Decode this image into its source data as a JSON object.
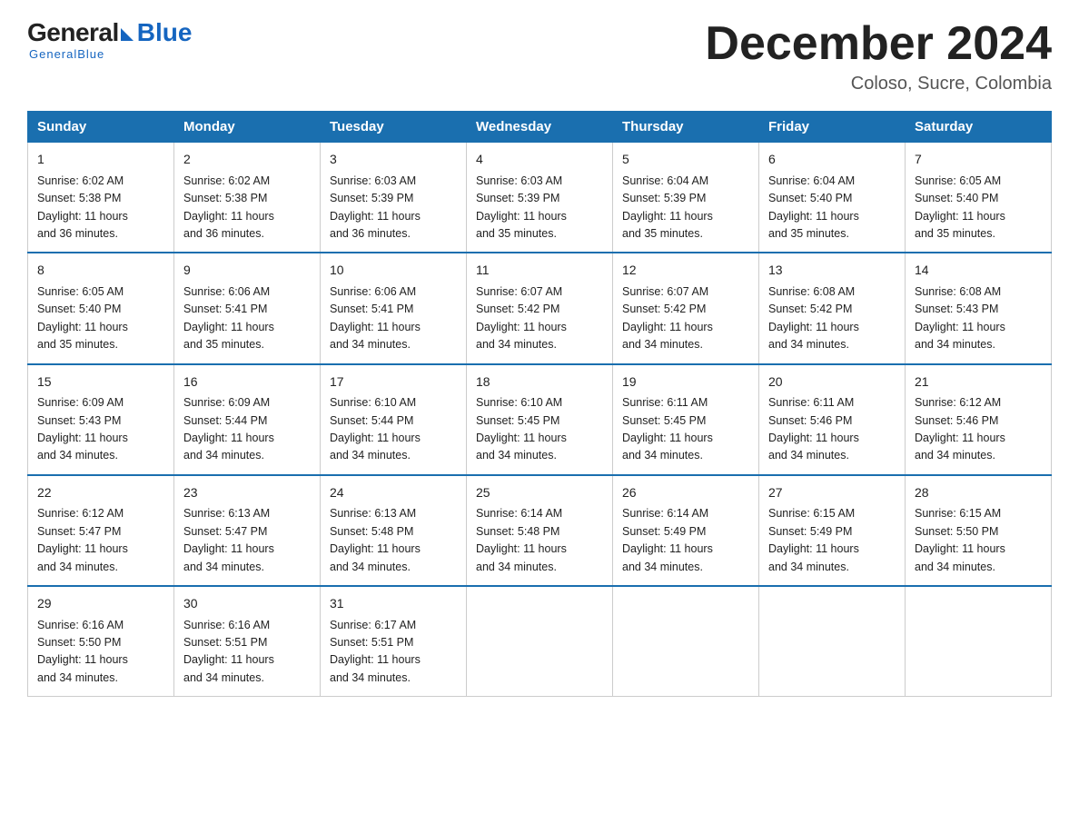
{
  "logo": {
    "general": "General",
    "blue": "Blue",
    "tagline": "GeneralBlue"
  },
  "header": {
    "month_title": "December 2024",
    "location": "Coloso, Sucre, Colombia"
  },
  "days_of_week": [
    "Sunday",
    "Monday",
    "Tuesday",
    "Wednesday",
    "Thursday",
    "Friday",
    "Saturday"
  ],
  "weeks": [
    [
      {
        "day": "1",
        "sunrise": "6:02 AM",
        "sunset": "5:38 PM",
        "daylight": "11 hours and 36 minutes."
      },
      {
        "day": "2",
        "sunrise": "6:02 AM",
        "sunset": "5:38 PM",
        "daylight": "11 hours and 36 minutes."
      },
      {
        "day": "3",
        "sunrise": "6:03 AM",
        "sunset": "5:39 PM",
        "daylight": "11 hours and 36 minutes."
      },
      {
        "day": "4",
        "sunrise": "6:03 AM",
        "sunset": "5:39 PM",
        "daylight": "11 hours and 35 minutes."
      },
      {
        "day": "5",
        "sunrise": "6:04 AM",
        "sunset": "5:39 PM",
        "daylight": "11 hours and 35 minutes."
      },
      {
        "day": "6",
        "sunrise": "6:04 AM",
        "sunset": "5:40 PM",
        "daylight": "11 hours and 35 minutes."
      },
      {
        "day": "7",
        "sunrise": "6:05 AM",
        "sunset": "5:40 PM",
        "daylight": "11 hours and 35 minutes."
      }
    ],
    [
      {
        "day": "8",
        "sunrise": "6:05 AM",
        "sunset": "5:40 PM",
        "daylight": "11 hours and 35 minutes."
      },
      {
        "day": "9",
        "sunrise": "6:06 AM",
        "sunset": "5:41 PM",
        "daylight": "11 hours and 35 minutes."
      },
      {
        "day": "10",
        "sunrise": "6:06 AM",
        "sunset": "5:41 PM",
        "daylight": "11 hours and 34 minutes."
      },
      {
        "day": "11",
        "sunrise": "6:07 AM",
        "sunset": "5:42 PM",
        "daylight": "11 hours and 34 minutes."
      },
      {
        "day": "12",
        "sunrise": "6:07 AM",
        "sunset": "5:42 PM",
        "daylight": "11 hours and 34 minutes."
      },
      {
        "day": "13",
        "sunrise": "6:08 AM",
        "sunset": "5:42 PM",
        "daylight": "11 hours and 34 minutes."
      },
      {
        "day": "14",
        "sunrise": "6:08 AM",
        "sunset": "5:43 PM",
        "daylight": "11 hours and 34 minutes."
      }
    ],
    [
      {
        "day": "15",
        "sunrise": "6:09 AM",
        "sunset": "5:43 PM",
        "daylight": "11 hours and 34 minutes."
      },
      {
        "day": "16",
        "sunrise": "6:09 AM",
        "sunset": "5:44 PM",
        "daylight": "11 hours and 34 minutes."
      },
      {
        "day": "17",
        "sunrise": "6:10 AM",
        "sunset": "5:44 PM",
        "daylight": "11 hours and 34 minutes."
      },
      {
        "day": "18",
        "sunrise": "6:10 AM",
        "sunset": "5:45 PM",
        "daylight": "11 hours and 34 minutes."
      },
      {
        "day": "19",
        "sunrise": "6:11 AM",
        "sunset": "5:45 PM",
        "daylight": "11 hours and 34 minutes."
      },
      {
        "day": "20",
        "sunrise": "6:11 AM",
        "sunset": "5:46 PM",
        "daylight": "11 hours and 34 minutes."
      },
      {
        "day": "21",
        "sunrise": "6:12 AM",
        "sunset": "5:46 PM",
        "daylight": "11 hours and 34 minutes."
      }
    ],
    [
      {
        "day": "22",
        "sunrise": "6:12 AM",
        "sunset": "5:47 PM",
        "daylight": "11 hours and 34 minutes."
      },
      {
        "day": "23",
        "sunrise": "6:13 AM",
        "sunset": "5:47 PM",
        "daylight": "11 hours and 34 minutes."
      },
      {
        "day": "24",
        "sunrise": "6:13 AM",
        "sunset": "5:48 PM",
        "daylight": "11 hours and 34 minutes."
      },
      {
        "day": "25",
        "sunrise": "6:14 AM",
        "sunset": "5:48 PM",
        "daylight": "11 hours and 34 minutes."
      },
      {
        "day": "26",
        "sunrise": "6:14 AM",
        "sunset": "5:49 PM",
        "daylight": "11 hours and 34 minutes."
      },
      {
        "day": "27",
        "sunrise": "6:15 AM",
        "sunset": "5:49 PM",
        "daylight": "11 hours and 34 minutes."
      },
      {
        "day": "28",
        "sunrise": "6:15 AM",
        "sunset": "5:50 PM",
        "daylight": "11 hours and 34 minutes."
      }
    ],
    [
      {
        "day": "29",
        "sunrise": "6:16 AM",
        "sunset": "5:50 PM",
        "daylight": "11 hours and 34 minutes."
      },
      {
        "day": "30",
        "sunrise": "6:16 AM",
        "sunset": "5:51 PM",
        "daylight": "11 hours and 34 minutes."
      },
      {
        "day": "31",
        "sunrise": "6:17 AM",
        "sunset": "5:51 PM",
        "daylight": "11 hours and 34 minutes."
      },
      null,
      null,
      null,
      null
    ]
  ],
  "labels": {
    "sunrise": "Sunrise:",
    "sunset": "Sunset:",
    "daylight": "Daylight:"
  }
}
